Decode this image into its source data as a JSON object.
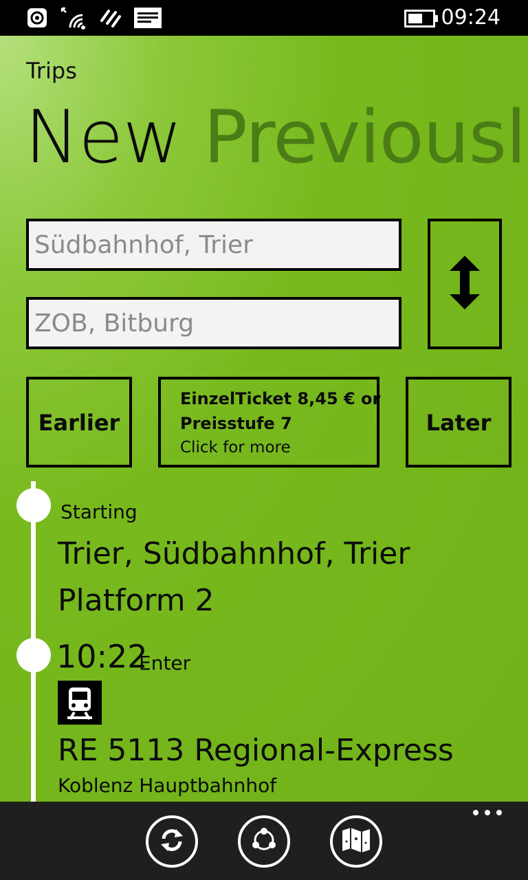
{
  "status_bar": {
    "time": "09:24",
    "icons": [
      "nfc-icon",
      "signal-icon",
      "network-icon",
      "message-icon",
      "battery-icon"
    ]
  },
  "app": {
    "title": "Trips",
    "pivot": {
      "active": "New",
      "next": "Previously"
    }
  },
  "form": {
    "from_value": "Südbahnhof, Trier",
    "to_value": "ZOB, Bitburg",
    "swap_icon": "swap-vertical-icon"
  },
  "actions": {
    "earlier_label": "Earlier",
    "later_label": "Later",
    "ticket": {
      "line1": "EinzelTicket 8,45 € or",
      "line2": "Preisstufe 7",
      "line3": "Click for more"
    }
  },
  "itinerary": {
    "start": {
      "label": "Starting",
      "station": "Trier, Südbahnhof, Trier",
      "platform": "Platform 2"
    },
    "leg": {
      "time": "10:22",
      "action": "Enter",
      "icon": "train-icon",
      "service": "RE 5113 Regional-Express",
      "direction": "Koblenz Hauptbahnhof"
    }
  },
  "app_bar": {
    "buttons": [
      "refresh-icon",
      "share-icon",
      "map-icon"
    ],
    "more_icon": "more-icon"
  },
  "colors": {
    "accent_green": "#78ba1e",
    "inactive_pivot": "#4b7d16",
    "app_bar": "#1f1f1f"
  }
}
